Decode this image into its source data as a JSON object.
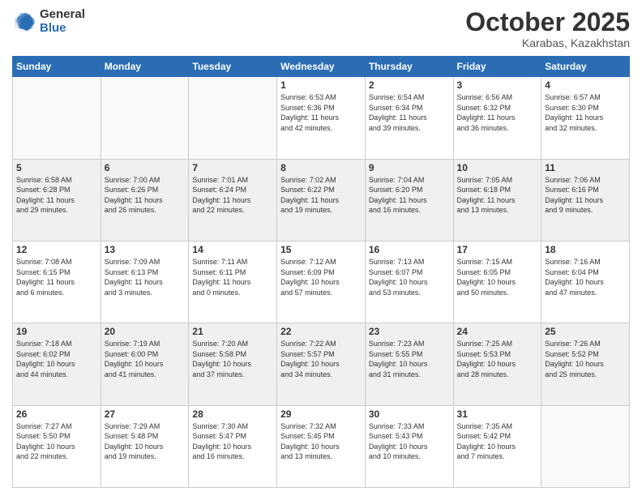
{
  "logo": {
    "general": "General",
    "blue": "Blue"
  },
  "header": {
    "month": "October 2025",
    "location": "Karabas, Kazakhstan"
  },
  "weekdays": [
    "Sunday",
    "Monday",
    "Tuesday",
    "Wednesday",
    "Thursday",
    "Friday",
    "Saturday"
  ],
  "weeks": [
    [
      {
        "day": "",
        "info": ""
      },
      {
        "day": "",
        "info": ""
      },
      {
        "day": "",
        "info": ""
      },
      {
        "day": "1",
        "info": "Sunrise: 6:53 AM\nSunset: 6:36 PM\nDaylight: 11 hours\nand 42 minutes."
      },
      {
        "day": "2",
        "info": "Sunrise: 6:54 AM\nSunset: 6:34 PM\nDaylight: 11 hours\nand 39 minutes."
      },
      {
        "day": "3",
        "info": "Sunrise: 6:56 AM\nSunset: 6:32 PM\nDaylight: 11 hours\nand 36 minutes."
      },
      {
        "day": "4",
        "info": "Sunrise: 6:57 AM\nSunset: 6:30 PM\nDaylight: 11 hours\nand 32 minutes."
      }
    ],
    [
      {
        "day": "5",
        "info": "Sunrise: 6:58 AM\nSunset: 6:28 PM\nDaylight: 11 hours\nand 29 minutes."
      },
      {
        "day": "6",
        "info": "Sunrise: 7:00 AM\nSunset: 6:26 PM\nDaylight: 11 hours\nand 26 minutes."
      },
      {
        "day": "7",
        "info": "Sunrise: 7:01 AM\nSunset: 6:24 PM\nDaylight: 11 hours\nand 22 minutes."
      },
      {
        "day": "8",
        "info": "Sunrise: 7:02 AM\nSunset: 6:22 PM\nDaylight: 11 hours\nand 19 minutes."
      },
      {
        "day": "9",
        "info": "Sunrise: 7:04 AM\nSunset: 6:20 PM\nDaylight: 11 hours\nand 16 minutes."
      },
      {
        "day": "10",
        "info": "Sunrise: 7:05 AM\nSunset: 6:18 PM\nDaylight: 11 hours\nand 13 minutes."
      },
      {
        "day": "11",
        "info": "Sunrise: 7:06 AM\nSunset: 6:16 PM\nDaylight: 11 hours\nand 9 minutes."
      }
    ],
    [
      {
        "day": "12",
        "info": "Sunrise: 7:08 AM\nSunset: 6:15 PM\nDaylight: 11 hours\nand 6 minutes."
      },
      {
        "day": "13",
        "info": "Sunrise: 7:09 AM\nSunset: 6:13 PM\nDaylight: 11 hours\nand 3 minutes."
      },
      {
        "day": "14",
        "info": "Sunrise: 7:11 AM\nSunset: 6:11 PM\nDaylight: 11 hours\nand 0 minutes."
      },
      {
        "day": "15",
        "info": "Sunrise: 7:12 AM\nSunset: 6:09 PM\nDaylight: 10 hours\nand 57 minutes."
      },
      {
        "day": "16",
        "info": "Sunrise: 7:13 AM\nSunset: 6:07 PM\nDaylight: 10 hours\nand 53 minutes."
      },
      {
        "day": "17",
        "info": "Sunrise: 7:15 AM\nSunset: 6:05 PM\nDaylight: 10 hours\nand 50 minutes."
      },
      {
        "day": "18",
        "info": "Sunrise: 7:16 AM\nSunset: 6:04 PM\nDaylight: 10 hours\nand 47 minutes."
      }
    ],
    [
      {
        "day": "19",
        "info": "Sunrise: 7:18 AM\nSunset: 6:02 PM\nDaylight: 10 hours\nand 44 minutes."
      },
      {
        "day": "20",
        "info": "Sunrise: 7:19 AM\nSunset: 6:00 PM\nDaylight: 10 hours\nand 41 minutes."
      },
      {
        "day": "21",
        "info": "Sunrise: 7:20 AM\nSunset: 5:58 PM\nDaylight: 10 hours\nand 37 minutes."
      },
      {
        "day": "22",
        "info": "Sunrise: 7:22 AM\nSunset: 5:57 PM\nDaylight: 10 hours\nand 34 minutes."
      },
      {
        "day": "23",
        "info": "Sunrise: 7:23 AM\nSunset: 5:55 PM\nDaylight: 10 hours\nand 31 minutes."
      },
      {
        "day": "24",
        "info": "Sunrise: 7:25 AM\nSunset: 5:53 PM\nDaylight: 10 hours\nand 28 minutes."
      },
      {
        "day": "25",
        "info": "Sunrise: 7:26 AM\nSunset: 5:52 PM\nDaylight: 10 hours\nand 25 minutes."
      }
    ],
    [
      {
        "day": "26",
        "info": "Sunrise: 7:27 AM\nSunset: 5:50 PM\nDaylight: 10 hours\nand 22 minutes."
      },
      {
        "day": "27",
        "info": "Sunrise: 7:29 AM\nSunset: 5:48 PM\nDaylight: 10 hours\nand 19 minutes."
      },
      {
        "day": "28",
        "info": "Sunrise: 7:30 AM\nSunset: 5:47 PM\nDaylight: 10 hours\nand 16 minutes."
      },
      {
        "day": "29",
        "info": "Sunrise: 7:32 AM\nSunset: 5:45 PM\nDaylight: 10 hours\nand 13 minutes."
      },
      {
        "day": "30",
        "info": "Sunrise: 7:33 AM\nSunset: 5:43 PM\nDaylight: 10 hours\nand 10 minutes."
      },
      {
        "day": "31",
        "info": "Sunrise: 7:35 AM\nSunset: 5:42 PM\nDaylight: 10 hours\nand 7 minutes."
      },
      {
        "day": "",
        "info": ""
      }
    ]
  ]
}
